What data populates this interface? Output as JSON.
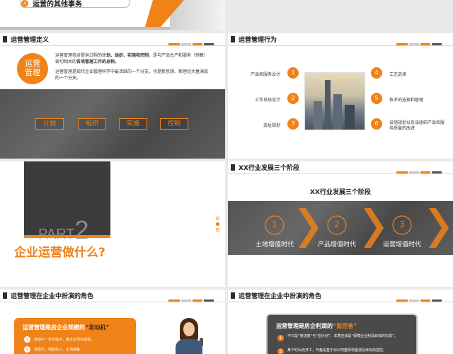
{
  "colors": {
    "accent": "#f08218",
    "dark": "#333333",
    "bg": "#e9e9e9"
  },
  "top_slide": {
    "item_number": "4",
    "item_text": "运营的其他事务"
  },
  "slide_definition": {
    "title": "运营管理定义",
    "circle_text_1": "运营",
    "circle_text_2": "管理",
    "para_1_a": "运营管理指对提供过程的",
    "para_1_b": "计划、组织、实施和控制",
    "para_1_c": "，是与产品生产和服务（销售）密切相关的",
    "para_1_d": "各项管理工作的总称。",
    "para_2": "运营管理是现代企业管理科学中最活跃的一个分支，也是新思想、新理论大量涌现的一个分支。",
    "tags": [
      "计划",
      "组织",
      "实施",
      "控制"
    ]
  },
  "slide_behavior": {
    "title": "运营管理行为",
    "left_items": [
      {
        "num": "1",
        "text": "产品和服务设计"
      },
      {
        "num": "2",
        "text": "工作系统设计"
      },
      {
        "num": "3",
        "text": "选址规划"
      }
    ],
    "right_items": [
      {
        "num": "4",
        "text": "工艺选择"
      },
      {
        "num": "5",
        "text": "技术的选择和管理"
      },
      {
        "num": "6",
        "text": "设施规划以及该组织产品和服务质量的改进"
      }
    ]
  },
  "slide_part": {
    "part_word": "PART",
    "part_number": "2",
    "heading": "企业运营做什么?"
  },
  "slide_stages": {
    "title": "XX行业发展三个阶段",
    "subtitle": "XX行业发展三个阶段",
    "stages": [
      {
        "num": "1",
        "label": "土地增值时代"
      },
      {
        "num": "2",
        "label": "产品增值时代"
      },
      {
        "num": "3",
        "label": "运营增值时代"
      }
    ]
  },
  "slide_role_a": {
    "title": "运营管理在企业中扮演的角色",
    "box_title_a": "运营管理是房企业规模的",
    "box_title_b": "“发动机”",
    "items": [
      {
        "num": "1",
        "text": "有钱不一定先做大，做大必须先做强。"
      },
      {
        "num": "2",
        "text": "规模大，销售收入、土地储备"
      }
    ]
  },
  "slide_role_b": {
    "title": "运营管理在企业中扮演的角色",
    "box_title_a": "运营管理是房企利润的",
    "box_title_b": "“监控者”",
    "items": [
      {
        "num": "1",
        "text": "不只是“管进度”与“控计划”，本质应该是“保障企业利润目标的实现”。"
      },
      {
        "num": "2",
        "text": "某个时间点开工，开盘是基于对公司整体现金流及目标的把控。"
      }
    ]
  }
}
